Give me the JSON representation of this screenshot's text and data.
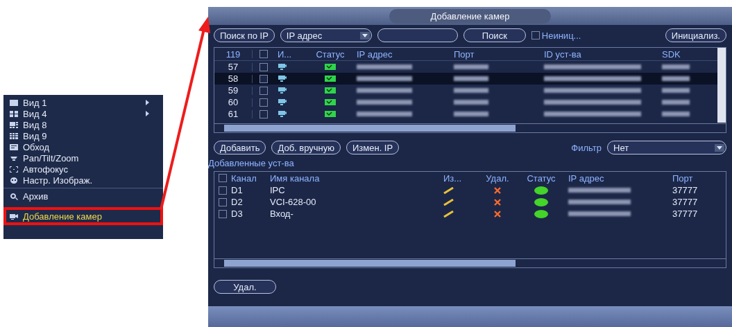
{
  "context_menu": {
    "items": [
      {
        "label": "Вид 1",
        "submenu": true,
        "selected": false,
        "divider_before": false
      },
      {
        "label": "Вид 4",
        "submenu": true,
        "selected": false,
        "divider_before": false
      },
      {
        "label": "Вид 8",
        "submenu": false,
        "selected": false,
        "divider_before": false
      },
      {
        "label": "Вид 9",
        "submenu": false,
        "selected": false,
        "divider_before": false
      },
      {
        "label": "Обход",
        "submenu": false,
        "selected": false,
        "divider_before": false
      },
      {
        "label": "Pan/Tilt/Zoom",
        "submenu": false,
        "selected": false,
        "divider_before": false
      },
      {
        "label": "Автофокус",
        "submenu": false,
        "selected": false,
        "divider_before": false
      },
      {
        "label": "Настр. Изображ.",
        "submenu": false,
        "selected": false,
        "divider_before": false
      },
      {
        "label": "Архив",
        "submenu": false,
        "selected": false,
        "divider_before": true
      },
      {
        "label": "Добавление камер",
        "submenu": false,
        "selected": true,
        "divider_before": false
      }
    ]
  },
  "dialog": {
    "title": "Добавление камер",
    "toolbar": {
      "search_by_ip_button": "Поиск по IP",
      "mode_select": "IP адрес",
      "search_button": "Поиск",
      "uninit_checkbox": {
        "label": "Неиниц...",
        "checked": false
      },
      "init_button": "Инициализ."
    },
    "found_table": {
      "all_checked": false,
      "columns": [
        "119",
        "И...",
        "Статус",
        "IP адрес",
        "Порт",
        "ID уст-ва",
        "SDK"
      ],
      "rows": [
        {
          "number": "57",
          "selected": false,
          "checked": false
        },
        {
          "number": "58",
          "selected": true,
          "checked": false
        },
        {
          "number": "59",
          "selected": false,
          "checked": false
        },
        {
          "number": "60",
          "selected": false,
          "checked": false
        },
        {
          "number": "61",
          "selected": false,
          "checked": false
        }
      ]
    },
    "action_buttons": [
      "Добавить",
      "Доб. вручную",
      "Измен. IP"
    ],
    "filter": {
      "label": "Фильтр",
      "value": "Нет"
    },
    "added_section_title": "Добавленные уст-ва",
    "added_table": {
      "all_checked": false,
      "columns": [
        "Канал",
        "Имя канала",
        "Из...",
        "Удал.",
        "Статус",
        "IP адрес",
        "Порт"
      ],
      "rows": [
        {
          "channel": "D1",
          "name": "IPC",
          "port": "37777",
          "checked": false,
          "online": true
        },
        {
          "channel": "D2",
          "name": "VCI-628-00",
          "port": "37777",
          "checked": false,
          "online": true
        },
        {
          "channel": "D3",
          "name": "Вход-",
          "port": "37777",
          "checked": false,
          "online": true
        }
      ]
    },
    "delete_button": "Удал."
  }
}
